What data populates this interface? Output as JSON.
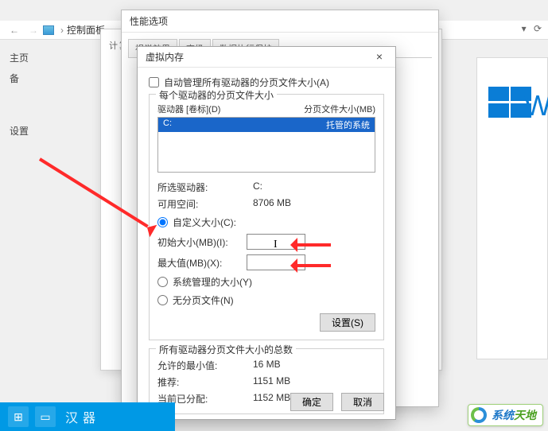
{
  "explorer": {
    "breadcrumb_label": "控制面板",
    "back_icon": "←",
    "fwd_icon": "→",
    "arrow_sep": "›",
    "dropdown_glyph": "▾",
    "refresh_glyph": "⟳"
  },
  "side": {
    "item0": "主页",
    "item1": "备",
    "item2": "设置"
  },
  "perf_dialog": {
    "title": "性能选项",
    "tab0": "视觉效果",
    "tab1": "高级",
    "tab2": "数据执行保护",
    "partial": "计算"
  },
  "vm_dialog": {
    "title": "虚拟内存",
    "close_glyph": "×",
    "auto_label": "自动管理所有驱动器的分页文件大小(A)",
    "group_drive_legend": "每个驱动器的分页文件大小",
    "col_drive": "驱动器 [卷标](D)",
    "col_paging": "分页文件大小(MB)",
    "drive0_name": "C:",
    "drive0_paging": "托管的系统",
    "selected_drive_label": "所选驱动器:",
    "selected_drive_value": "C:",
    "avail_label": "可用空间:",
    "avail_value": "8706 MB",
    "radio_custom": "自定义大小(C):",
    "initial_label": "初始大小(MB)(I):",
    "initial_value": "",
    "max_label": "最大值(MB)(X):",
    "max_value": "",
    "radio_system": "系统管理的大小(Y)",
    "radio_none": "无分页文件(N)",
    "set_btn": "设置(S)",
    "totals_legend": "所有驱动器分页文件大小的总数",
    "min_label": "允许的最小值:",
    "min_value": "16 MB",
    "rec_label": "推荐:",
    "rec_value": "1151 MB",
    "cur_label": "当前已分配:",
    "cur_value": "1152 MB",
    "ok_btn": "确定",
    "cancel_btn": "取消"
  },
  "taskbar": {
    "label": "汉器"
  },
  "watermark": {
    "t1": "系统",
    "t2": "天地"
  },
  "winlogo_text": "W"
}
